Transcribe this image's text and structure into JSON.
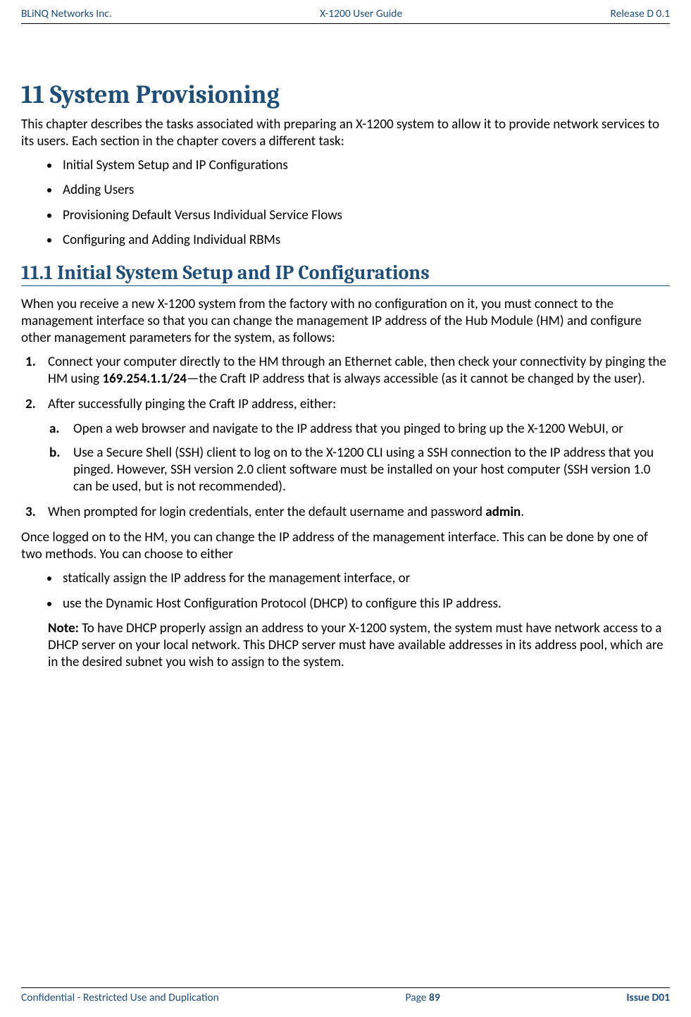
{
  "header": {
    "left": "BLiNQ Networks Inc.",
    "center": "X-1200 User Guide",
    "right": "Release D 0.1"
  },
  "chapter": {
    "title": "11 System Provisioning",
    "intro": "This chapter describes the tasks associated with preparing an X-1200 system to allow it to provide network services to its users. Each section in the chapter covers a different task:",
    "tasks": [
      "Initial System Setup and IP Configurations",
      "Adding Users",
      "Provisioning Default Versus Individual Service Flows",
      "Configuring and Adding Individual RBMs"
    ]
  },
  "section": {
    "title": "11.1 Initial System Setup and IP Configurations",
    "intro": "When you receive a new X-1200 system from the factory with no configuration on it, you must connect to the management interface so that you can change the management IP address of the Hub Module (HM) and configure other management parameters for the system, as follows:",
    "steps": {
      "s1_pre": "Connect your computer directly to the HM through an Ethernet cable, then check your connectivity by pinging the HM using ",
      "s1_bold": "169.254.1.1/24",
      "s1_post": "—the Craft IP address that is always accessible (as it cannot be changed by the user).",
      "s2_intro": "After successfully pinging the Craft IP address, either:",
      "s2a": "Open a web browser and navigate to the IP address that you pinged to bring up the X-1200 WebUI, or",
      "s2b": "Use a Secure Shell (SSH) client to log on to the X-1200 CLI using a SSH connection to the IP address that you pinged. However, SSH version 2.0 client software must be installed on your host computer (SSH version 1.0 can be used, but is not recommended).",
      "s3_pre": "When prompted for login credentials, enter the default username and password ",
      "s3_bold": "admin",
      "s3_post": "."
    },
    "after": "Once logged on to the HM, you can change the IP address of the management interface. This can be done by one of two methods. You can choose to either",
    "methods": [
      "statically assign the IP address for the management interface, or",
      "use the Dynamic Host Configuration Protocol (DHCP) to configure this IP address."
    ],
    "note_label": "Note:",
    "note_body": " To have DHCP properly assign an address to your X-1200 system, the system must have network access to a DHCP server on your local network. This DHCP server must have available addresses in its address pool, which are in the desired subnet you wish to assign to the system."
  },
  "footer": {
    "left": "Confidential - Restricted Use and Duplication",
    "center_label": "Page ",
    "center_page": "89",
    "right": "Issue D01"
  }
}
